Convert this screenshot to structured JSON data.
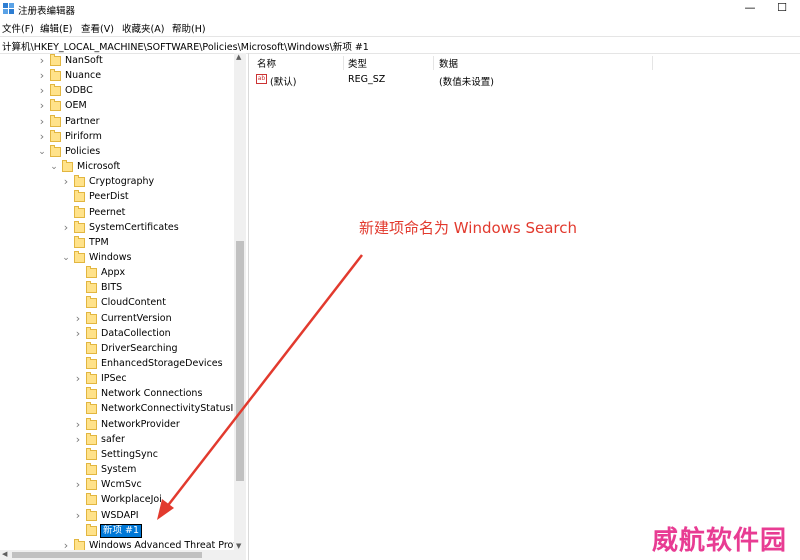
{
  "window": {
    "title": "注册表编辑器",
    "minimize_glyph": "—",
    "maximize_glyph": "☐"
  },
  "menu": [
    "文件(F)",
    "编辑(E)",
    "查看(V)",
    "收藏夹(A)",
    "帮助(H)"
  ],
  "address": "计算机\\HKEY_LOCAL_MACHINE\\SOFTWARE\\Policies\\Microsoft\\Windows\\新项 #1",
  "tree": [
    {
      "label": "NanSoft",
      "expander": "collapsed",
      "level": 0
    },
    {
      "label": "Nuance",
      "expander": "collapsed",
      "level": 0
    },
    {
      "label": "ODBC",
      "expander": "collapsed",
      "level": 0
    },
    {
      "label": "OEM",
      "expander": "collapsed",
      "level": 0
    },
    {
      "label": "Partner",
      "expander": "collapsed",
      "level": 0
    },
    {
      "label": "Piriform",
      "expander": "collapsed",
      "level": 0
    },
    {
      "label": "Policies",
      "expander": "expanded",
      "level": 0
    },
    {
      "label": "Microsoft",
      "expander": "expanded",
      "level": 1
    },
    {
      "label": "Cryptography",
      "expander": "collapsed",
      "level": 2
    },
    {
      "label": "PeerDist",
      "expander": "none",
      "level": 2
    },
    {
      "label": "Peernet",
      "expander": "none",
      "level": 2
    },
    {
      "label": "SystemCertificates",
      "expander": "collapsed",
      "level": 2
    },
    {
      "label": "TPM",
      "expander": "none",
      "level": 2
    },
    {
      "label": "Windows",
      "expander": "expanded",
      "level": 2
    },
    {
      "label": "Appx",
      "expander": "none",
      "level": 3
    },
    {
      "label": "BITS",
      "expander": "none",
      "level": 3
    },
    {
      "label": "CloudContent",
      "expander": "none",
      "level": 3
    },
    {
      "label": "CurrentVersion",
      "expander": "collapsed",
      "level": 3
    },
    {
      "label": "DataCollection",
      "expander": "collapsed",
      "level": 3
    },
    {
      "label": "DriverSearching",
      "expander": "none",
      "level": 3
    },
    {
      "label": "EnhancedStorageDevices",
      "expander": "none",
      "level": 3
    },
    {
      "label": "IPSec",
      "expander": "collapsed",
      "level": 3
    },
    {
      "label": "Network Connections",
      "expander": "none",
      "level": 3
    },
    {
      "label": "NetworkConnectivityStatusIndi",
      "expander": "none",
      "level": 3
    },
    {
      "label": "NetworkProvider",
      "expander": "collapsed",
      "level": 3
    },
    {
      "label": "safer",
      "expander": "collapsed",
      "level": 3
    },
    {
      "label": "SettingSync",
      "expander": "none",
      "level": 3
    },
    {
      "label": "System",
      "expander": "none",
      "level": 3
    },
    {
      "label": "WcmSvc",
      "expander": "collapsed",
      "level": 3
    },
    {
      "label": "WorkplaceJoi",
      "expander": "none",
      "level": 3
    },
    {
      "label": "WSDAPI",
      "expander": "collapsed",
      "level": 3
    },
    {
      "label": "新项 #1",
      "expander": "none",
      "level": 3,
      "editing": true
    },
    {
      "label": "Windows Advanced Threat Prote",
      "expander": "collapsed",
      "level": 2
    }
  ],
  "columns": {
    "name": "名称",
    "type": "类型",
    "data": "数据"
  },
  "values": [
    {
      "name": "(默认)",
      "type": "REG_SZ",
      "data": "(数值未设置)",
      "icon": "ab"
    }
  ],
  "annotation": "新建项命名为 Windows Search",
  "watermark": "威航软件园",
  "colors": {
    "annotation": "#e23a2e",
    "watermark": "#e83c93",
    "selection": "#0078d7"
  }
}
